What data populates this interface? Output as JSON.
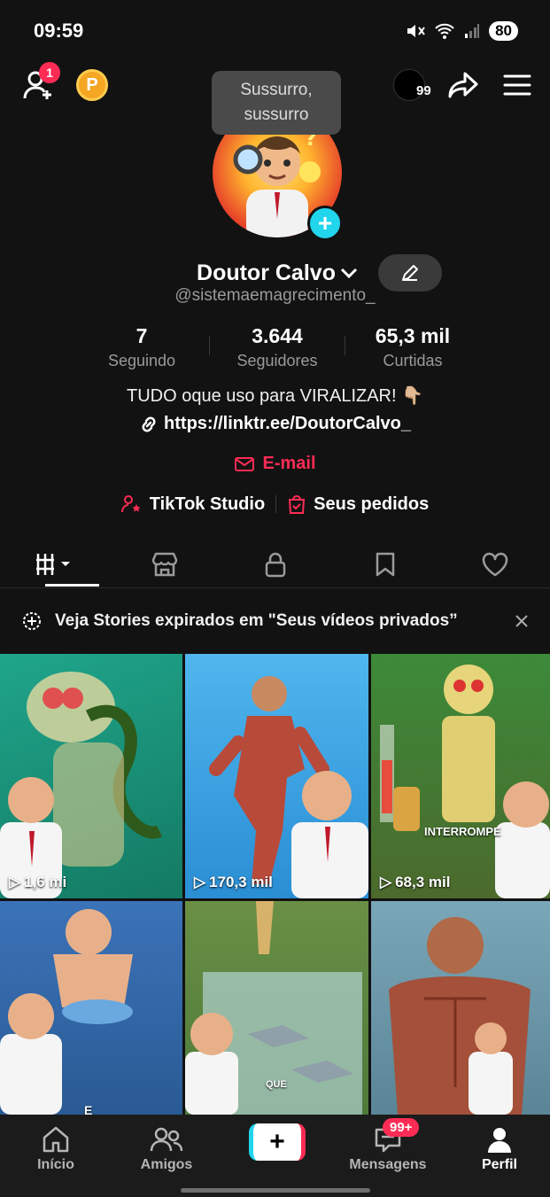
{
  "status_bar": {
    "time": "09:59",
    "battery": "80"
  },
  "topbar": {
    "friend_badge": "1",
    "points_label": "P",
    "story_count": "99"
  },
  "tooltip": {
    "text": "Sussurro, sussurro"
  },
  "profile": {
    "display_name": "Doutor Calvo",
    "username": "@sistemaemagrecimento_",
    "bio": "TUDO oque uso para VIRALIZAR! 👇🏼",
    "link": "https://linktr.ee/DoutorCalvo_",
    "email_label": "E-mail"
  },
  "stats": [
    {
      "value": "7",
      "label": "Seguindo"
    },
    {
      "value": "3.644",
      "label": "Seguidores"
    },
    {
      "value": "65,3 mil",
      "label": "Curtidas"
    }
  ],
  "tools": {
    "studio": "TikTok Studio",
    "orders": "Seus pedidos"
  },
  "banner": {
    "text": "Veja Stories expirados em \"Seus vídeos privados”"
  },
  "videos": [
    {
      "views": "1,6 mi"
    },
    {
      "views": "170,3 mil"
    },
    {
      "views": "68,3 mil",
      "overlay": "INTERROMPE"
    },
    {
      "views": "",
      "overlay": "E"
    },
    {
      "views": "",
      "overlay": "QUE"
    },
    {
      "views": ""
    }
  ],
  "nav": {
    "home": "Início",
    "friends": "Amigos",
    "messages": "Mensagens",
    "messages_badge": "99+",
    "profile": "Perfil"
  },
  "colors": {
    "accent_red": "#fe2c55",
    "accent_cyan": "#20d5ec",
    "background": "#121212"
  }
}
